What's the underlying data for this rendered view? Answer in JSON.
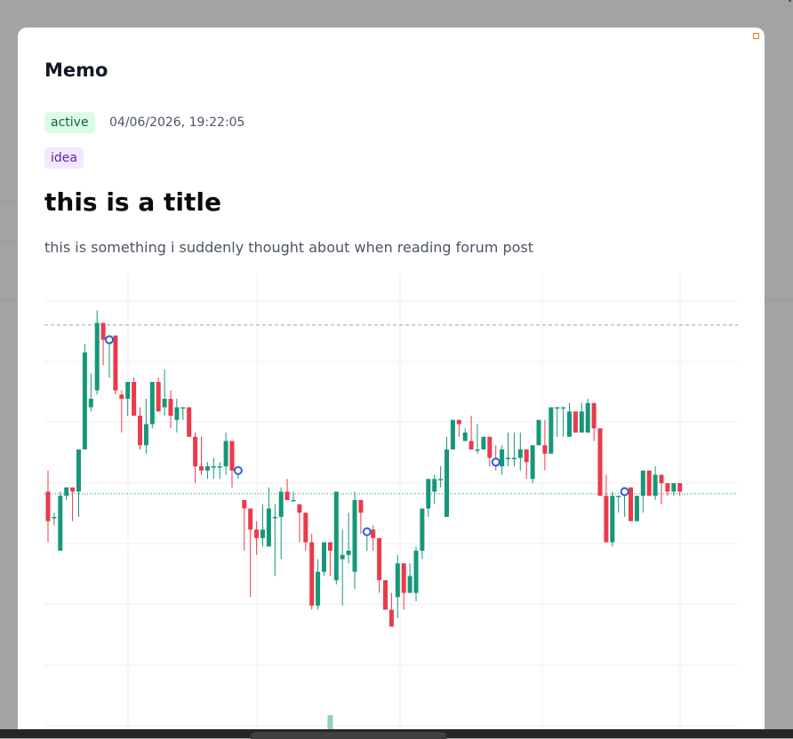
{
  "modal": {
    "title": "Memo",
    "status": "active",
    "timestamp": "04/06/2026, 19:22:05",
    "tag": "idea",
    "heading": "this is a title",
    "body": "this is something i suddenly thought about when reading forum post"
  },
  "colors": {
    "up": "#16977a",
    "down": "#ec3a4a",
    "marker": "#2e5fd8",
    "status_bg": "#dcfce7",
    "tag_bg": "#f3e8ff"
  },
  "icons": {
    "corner": "orange-square-icon"
  },
  "chart_data": {
    "type": "candlestick",
    "grid": true,
    "ylim": [
      0,
      100
    ],
    "reference_lines": {
      "dashed_level": 89.5,
      "dotted_level": 49.5
    },
    "candles": [
      {
        "o": 50,
        "h": 55,
        "l": 38,
        "c": 43
      },
      {
        "o": 44,
        "h": 45,
        "l": 42,
        "c": 44
      },
      {
        "o": 36,
        "h": 50,
        "l": 36,
        "c": 49
      },
      {
        "o": 49,
        "h": 51,
        "l": 48,
        "c": 51
      },
      {
        "o": 51,
        "h": 51,
        "l": 43,
        "c": 50
      },
      {
        "o": 50,
        "h": 60,
        "l": 44,
        "c": 60
      },
      {
        "o": 60,
        "h": 85,
        "l": 60,
        "c": 83
      },
      {
        "o": 70,
        "h": 78,
        "l": 69,
        "c": 72
      },
      {
        "o": 74,
        "h": 93,
        "l": 73,
        "c": 90
      },
      {
        "o": 90,
        "h": 89,
        "l": 80,
        "c": 86
      },
      {
        "o": 85,
        "h": 86,
        "l": 77,
        "c": 87
      },
      {
        "o": 87,
        "h": 87,
        "l": 73,
        "c": 74
      },
      {
        "o": 73,
        "h": 74,
        "l": 64,
        "c": 72
      },
      {
        "o": 72,
        "h": 76,
        "l": 68,
        "c": 76
      },
      {
        "o": 76,
        "h": 77,
        "l": 68,
        "c": 68
      },
      {
        "o": 68,
        "h": 70,
        "l": 60,
        "c": 61
      },
      {
        "o": 61,
        "h": 72,
        "l": 59,
        "c": 66
      },
      {
        "o": 66,
        "h": 76,
        "l": 65,
        "c": 76
      },
      {
        "o": 76,
        "h": 77,
        "l": 70,
        "c": 69
      },
      {
        "o": 70,
        "h": 79,
        "l": 68,
        "c": 72
      },
      {
        "o": 72,
        "h": 74,
        "l": 65,
        "c": 68
      },
      {
        "o": 67,
        "h": 72,
        "l": 64,
        "c": 70
      },
      {
        "o": 70,
        "h": 68,
        "l": 67,
        "c": 70
      },
      {
        "o": 70,
        "h": 67,
        "l": 63,
        "c": 63
      },
      {
        "o": 63,
        "h": 64,
        "l": 52,
        "c": 56
      },
      {
        "o": 56,
        "h": 63,
        "l": 54,
        "c": 55
      },
      {
        "o": 55,
        "h": 57,
        "l": 53,
        "c": 56
      },
      {
        "o": 56,
        "h": 58,
        "l": 53,
        "c": 56
      },
      {
        "o": 56,
        "h": 57,
        "l": 53,
        "c": 56
      },
      {
        "o": 56,
        "h": 64,
        "l": 54,
        "c": 62
      },
      {
        "o": 62,
        "h": 60,
        "l": 51,
        "c": 55
      },
      {
        "o": 55,
        "h": 55,
        "l": 53,
        "c": 55
      },
      {
        "o": 48,
        "h": 47,
        "l": 36,
        "c": 46
      },
      {
        "o": 46,
        "h": 46,
        "l": 25,
        "c": 41
      },
      {
        "o": 41,
        "h": 43,
        "l": 35,
        "c": 39
      },
      {
        "o": 39,
        "h": 47,
        "l": 37,
        "c": 41
      },
      {
        "o": 37,
        "h": 51,
        "l": 37,
        "c": 46
      },
      {
        "o": 44,
        "h": 47,
        "l": 30,
        "c": 44
      },
      {
        "o": 44,
        "h": 51,
        "l": 34,
        "c": 50
      },
      {
        "o": 50,
        "h": 53,
        "l": 48,
        "c": 48
      },
      {
        "o": 48,
        "h": 50,
        "l": 48,
        "c": 48
      },
      {
        "o": 47,
        "h": 45,
        "l": 38,
        "c": 45
      },
      {
        "o": 45,
        "h": 44,
        "l": 36,
        "c": 38
      },
      {
        "o": 38,
        "h": 40,
        "l": 22,
        "c": 23
      },
      {
        "o": 23,
        "h": 34,
        "l": 22,
        "c": 31
      },
      {
        "o": 31,
        "h": 38,
        "l": 30,
        "c": 38
      },
      {
        "o": 38,
        "h": 38,
        "l": 30,
        "c": 36
      },
      {
        "o": 29,
        "h": 50,
        "l": 28,
        "c": 50
      },
      {
        "o": 34,
        "h": 41,
        "l": 23,
        "c": 35
      },
      {
        "o": 35,
        "h": 45,
        "l": 33,
        "c": 36
      },
      {
        "o": 31,
        "h": 50,
        "l": 27,
        "c": 48
      },
      {
        "o": 48,
        "h": 48,
        "l": 40,
        "c": 45
      },
      {
        "o": 40,
        "h": 40,
        "l": 36,
        "c": 41
      },
      {
        "o": 41,
        "h": 42,
        "l": 36,
        "c": 39
      },
      {
        "o": 39,
        "h": 34,
        "l": 26,
        "c": 29
      },
      {
        "o": 29,
        "h": 28,
        "l": 23,
        "c": 22
      },
      {
        "o": 22,
        "h": 26,
        "l": 19,
        "c": 18
      },
      {
        "o": 25,
        "h": 35,
        "l": 20,
        "c": 33
      },
      {
        "o": 33,
        "h": 32,
        "l": 22,
        "c": 26
      },
      {
        "o": 26,
        "h": 33,
        "l": 26,
        "c": 30
      },
      {
        "o": 26,
        "h": 37,
        "l": 24,
        "c": 36
      },
      {
        "o": 36,
        "h": 44,
        "l": 34,
        "c": 46
      },
      {
        "o": 46,
        "h": 53,
        "l": 44,
        "c": 53
      },
      {
        "o": 50,
        "h": 54,
        "l": 47,
        "c": 53
      },
      {
        "o": 53,
        "h": 56,
        "l": 51,
        "c": 53
      },
      {
        "o": 44,
        "h": 63,
        "l": 44,
        "c": 60
      },
      {
        "o": 60,
        "h": 67,
        "l": 60,
        "c": 67
      },
      {
        "o": 67,
        "h": 66,
        "l": 63,
        "c": 66
      },
      {
        "o": 62,
        "h": 65,
        "l": 62,
        "c": 64
      },
      {
        "o": 62,
        "h": 68,
        "l": 60,
        "c": 60
      },
      {
        "o": 60,
        "h": 66,
        "l": 59,
        "c": 60
      },
      {
        "o": 60,
        "h": 63,
        "l": 60,
        "c": 63
      },
      {
        "o": 63,
        "h": 63,
        "l": 56,
        "c": 58
      },
      {
        "o": 58,
        "h": 61,
        "l": 55,
        "c": 56
      },
      {
        "o": 56,
        "h": 61,
        "l": 54,
        "c": 60
      },
      {
        "o": 58,
        "h": 64,
        "l": 56,
        "c": 58
      },
      {
        "o": 58,
        "h": 64,
        "l": 56,
        "c": 58
      },
      {
        "o": 58,
        "h": 64,
        "l": 55,
        "c": 60
      },
      {
        "o": 60,
        "h": 58,
        "l": 53,
        "c": 57
      },
      {
        "o": 53,
        "h": 61,
        "l": 52,
        "c": 61
      },
      {
        "o": 61,
        "h": 67,
        "l": 61,
        "c": 67
      },
      {
        "o": 61,
        "h": 67,
        "l": 55,
        "c": 59
      },
      {
        "o": 59,
        "h": 70,
        "l": 59,
        "c": 70
      },
      {
        "o": 70,
        "h": 65,
        "l": 63,
        "c": 70
      },
      {
        "o": 70,
        "h": 69,
        "l": 63,
        "c": 70
      },
      {
        "o": 63,
        "h": 71,
        "l": 63,
        "c": 69
      },
      {
        "o": 69,
        "h": 69,
        "l": 64,
        "c": 64
      },
      {
        "o": 64,
        "h": 71,
        "l": 64,
        "c": 69
      },
      {
        "o": 64,
        "h": 72,
        "l": 64,
        "c": 71
      },
      {
        "o": 71,
        "h": 71,
        "l": 62,
        "c": 65
      },
      {
        "o": 65,
        "h": 63,
        "l": 49,
        "c": 49
      },
      {
        "o": 49,
        "h": 54,
        "l": 43,
        "c": 38
      },
      {
        "o": 38,
        "h": 50,
        "l": 37,
        "c": 49
      },
      {
        "o": 49,
        "h": 48,
        "l": 45,
        "c": 49
      },
      {
        "o": 49,
        "h": 50,
        "l": 44,
        "c": 51
      },
      {
        "o": 51,
        "h": 51,
        "l": 43,
        "c": 43
      },
      {
        "o": 43,
        "h": 49,
        "l": 43,
        "c": 49
      },
      {
        "o": 49,
        "h": 50,
        "l": 45,
        "c": 55
      },
      {
        "o": 55,
        "h": 54,
        "l": 49,
        "c": 49
      },
      {
        "o": 49,
        "h": 56,
        "l": 48,
        "c": 54
      },
      {
        "o": 54,
        "h": 51,
        "l": 47,
        "c": 52
      },
      {
        "o": 52,
        "h": 52,
        "l": 49,
        "c": 50
      },
      {
        "o": 50,
        "h": 52,
        "l": 49,
        "c": 52
      },
      {
        "o": 52,
        "h": 51,
        "l": 49,
        "c": 50
      }
    ],
    "markers_at_candles": [
      10,
      31,
      52,
      73,
      94
    ],
    "volume_bar_at_candle": 46
  }
}
